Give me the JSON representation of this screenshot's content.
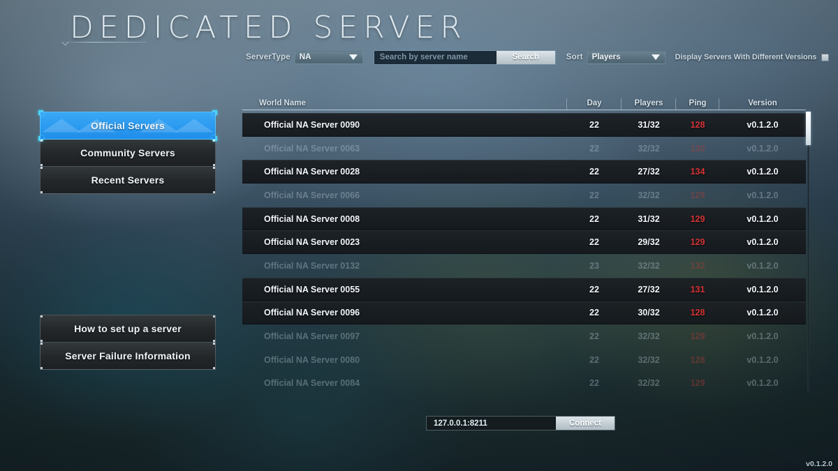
{
  "page": {
    "title": "DEDICATED SERVER",
    "build_version": "v0.1.2.0"
  },
  "toolbar": {
    "server_type_label": "ServerType",
    "server_type_value": "NA",
    "server_type_options": [
      "NA"
    ],
    "search_placeholder": "Search by server name",
    "search_value": "",
    "search_button": "Search",
    "sort_label": "Sort",
    "sort_value": "Players",
    "sort_options": [
      "Players"
    ],
    "different_versions_label": "Display Servers With Different Versions",
    "different_versions_checked": false
  },
  "nav": {
    "items": [
      {
        "label": "Official Servers",
        "selected": true
      },
      {
        "label": "Community Servers",
        "selected": false
      },
      {
        "label": "Recent Servers",
        "selected": false
      }
    ],
    "help_items": [
      {
        "label": "How to set up a server"
      },
      {
        "label": "Server Failure Information"
      }
    ]
  },
  "table": {
    "headers": {
      "world_name": "World Name",
      "day": "Day",
      "players": "Players",
      "ping": "Ping",
      "version": "Version"
    },
    "rows": [
      {
        "name": "Official NA Server 0090",
        "day": "22",
        "players": "31/32",
        "ping": "128",
        "version": "v0.1.2.0",
        "full": false
      },
      {
        "name": "Official NA Server 0063",
        "day": "22",
        "players": "32/32",
        "ping": "130",
        "version": "v0.1.2.0",
        "full": true
      },
      {
        "name": "Official NA Server 0028",
        "day": "22",
        "players": "27/32",
        "ping": "134",
        "version": "v0.1.2.0",
        "full": false
      },
      {
        "name": "Official NA Server 0066",
        "day": "22",
        "players": "32/32",
        "ping": "129",
        "version": "v0.1.2.0",
        "full": true
      },
      {
        "name": "Official NA Server 0008",
        "day": "22",
        "players": "31/32",
        "ping": "129",
        "version": "v0.1.2.0",
        "full": false
      },
      {
        "name": "Official NA Server 0023",
        "day": "22",
        "players": "29/32",
        "ping": "129",
        "version": "v0.1.2.0",
        "full": false
      },
      {
        "name": "Official NA Server 0132",
        "day": "23",
        "players": "32/32",
        "ping": "132",
        "version": "v0.1.2.0",
        "full": true
      },
      {
        "name": "Official NA Server 0055",
        "day": "22",
        "players": "27/32",
        "ping": "131",
        "version": "v0.1.2.0",
        "full": false
      },
      {
        "name": "Official NA Server 0096",
        "day": "22",
        "players": "30/32",
        "ping": "128",
        "version": "v0.1.2.0",
        "full": false
      },
      {
        "name": "Official NA Server 0097",
        "day": "22",
        "players": "32/32",
        "ping": "129",
        "version": "v0.1.2.0",
        "full": true
      },
      {
        "name": "Official NA Server 0080",
        "day": "22",
        "players": "32/32",
        "ping": "128",
        "version": "v0.1.2.0",
        "full": true
      },
      {
        "name": "Official NA Server 0084",
        "day": "22",
        "players": "32/32",
        "ping": "129",
        "version": "v0.1.2.0",
        "full": true
      }
    ]
  },
  "connect": {
    "address_value": "127.0.0.1:8211",
    "address_placeholder": "127.0.0.1:8211",
    "button_label": "Connect"
  },
  "colors": {
    "accent_blue": "#2b9af0",
    "selection_cyan": "#49d8ff",
    "ping_red": "#d53333"
  }
}
